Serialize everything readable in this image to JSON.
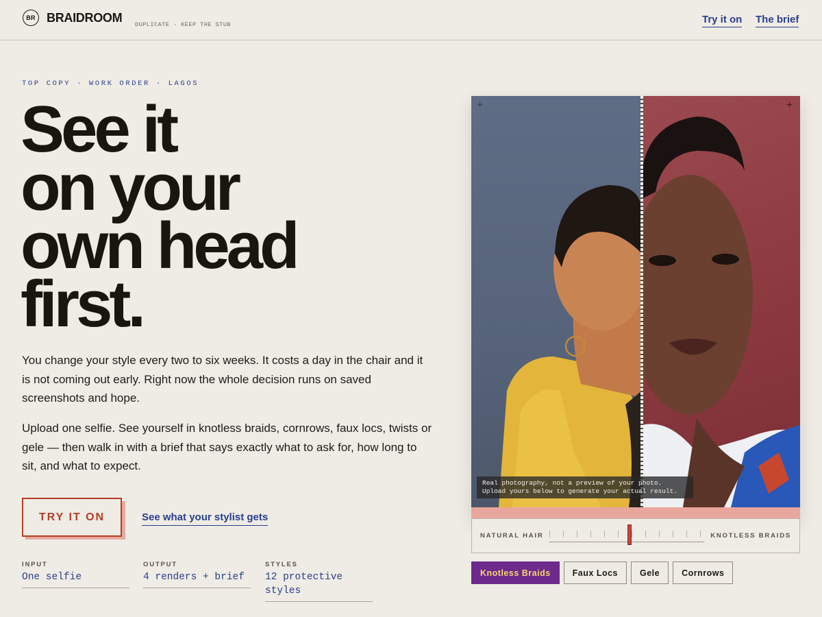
{
  "header": {
    "logo_mark": "BR",
    "brand": "BRAIDROOM",
    "tagline": "DUPLICATE · KEEP THE STUB",
    "nav": [
      {
        "label": "Try it on"
      },
      {
        "label": "The brief"
      }
    ]
  },
  "hero": {
    "eyebrow": "TOP COPY · WORK ORDER · LAGOS",
    "headline_lines": [
      "See it",
      "on your",
      "own head",
      "first."
    ],
    "paragraphs": [
      "You change your style every two to six weeks. It costs a day in the chair and it is not coming out early. Right now the whole decision runs on saved screenshots and hope.",
      "Upload one selfie. See yourself in knotless braids, cornrows, faux locs, twists or gele — then walk in with a brief that says exactly what to ask for, how long to sit, and what to expect."
    ],
    "cta_label": "TRY IT ON",
    "secondary_link": "See what your stylist gets",
    "stats": [
      {
        "label": "INPUT",
        "value": "One selfie"
      },
      {
        "label": "OUTPUT",
        "value": "4 renders + brief"
      },
      {
        "label": "STYLES",
        "value": "12 protective styles"
      }
    ]
  },
  "preview": {
    "caption_line1": "Real photography, not a preview of your photo.",
    "caption_line2": "Upload yours below to generate your actual result.",
    "slider_left": "NATURAL HAIR",
    "slider_right": "KNOTLESS BRAIDS",
    "slider_value_fraction": 0.52,
    "style_chips": [
      {
        "label": "Knotless Braids",
        "active": true
      },
      {
        "label": "Faux Locs",
        "active": false
      },
      {
        "label": "Gele",
        "active": false
      },
      {
        "label": "Cornrows",
        "active": false
      }
    ]
  },
  "colors": {
    "background": "#efebe5",
    "ink": "#19160f",
    "link_blue": "#2a3f8a",
    "cta_red": "#b53c25",
    "chip_active_bg": "#6d2a8c",
    "chip_active_text": "#f6d774"
  },
  "icons": [
    "crosshair-icon",
    "crosshair-icon"
  ]
}
